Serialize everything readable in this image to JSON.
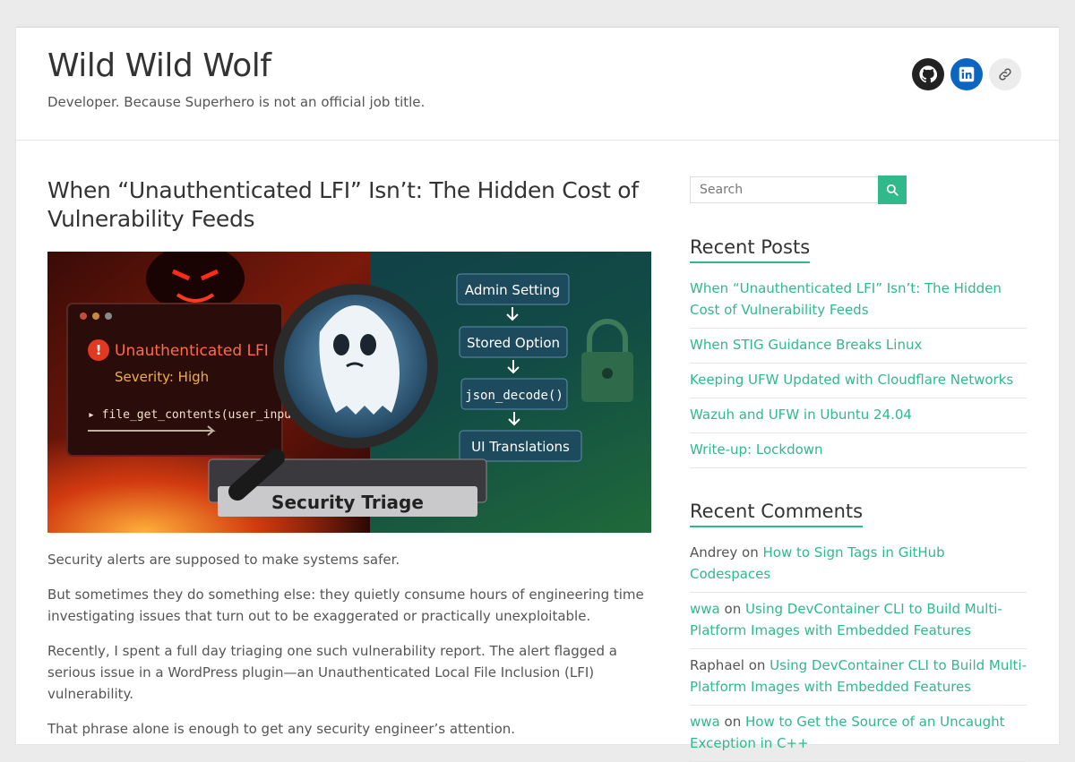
{
  "header": {
    "site_title": "Wild Wild Wolf",
    "site_description": "Developer. Because Superhero is not an official job title.",
    "social": [
      {
        "icon": "github-icon"
      },
      {
        "icon": "linkedin-icon"
      },
      {
        "icon": "link-icon"
      }
    ]
  },
  "post": {
    "title": "When “Unauthenticated LFI” Isn’t: The Hidden Cost of Vulnerability Feeds",
    "image": {
      "alert_title": "Unauthenticated LFI",
      "severity": "Severity: High",
      "code": "▸ file_get_contents(user_input):",
      "flow": [
        "Admin Setting",
        "Stored Option",
        "json_decode()",
        "UI Translations"
      ],
      "banner": "Security Triage"
    },
    "paragraphs": [
      "Security alerts are supposed to make systems safer.",
      "But sometimes they do something else: they quietly consume hours of engineering time investigating issues that turn out to be exaggerated or practically unexploitable.",
      "Recently, I spent a full day triaging one such vulnerability report. The alert flagged a serious issue in a WordPress plugin—an Unauthenticated Local File Inclusion (LFI) vulnerability.",
      "That phrase alone is enough to get any security engineer’s attention."
    ]
  },
  "sidebar": {
    "search": {
      "placeholder": "Search"
    },
    "recent_posts": {
      "title": "Recent Posts",
      "items": [
        "When “Unauthenticated LFI” Isn’t: The Hidden Cost of Vulnerability Feeds",
        "When STIG Guidance Breaks Linux",
        "Keeping UFW Updated with Cloudflare Networks",
        "Wazuh and UFW in Ubuntu 24.04",
        "Write-up: Lockdown"
      ]
    },
    "recent_comments": {
      "title": "Recent Comments",
      "on_word": "on",
      "items": [
        {
          "author": "Andrey",
          "post": "How to Sign Tags in GitHub Codespaces"
        },
        {
          "author": "wwa",
          "post": "Using DevContainer CLI to Build Multi-Platform Images with Embedded Features"
        },
        {
          "author": "Raphael",
          "post": "Using DevContainer CLI to Build Multi-Platform Images with Embedded Features"
        },
        {
          "author": "wwa",
          "post": "How to Get the Source of an Uncaught Exception in C++"
        }
      ]
    }
  },
  "colors": {
    "accent": "#30b98a",
    "github": "#222222",
    "linkedin": "#0a66c2"
  }
}
